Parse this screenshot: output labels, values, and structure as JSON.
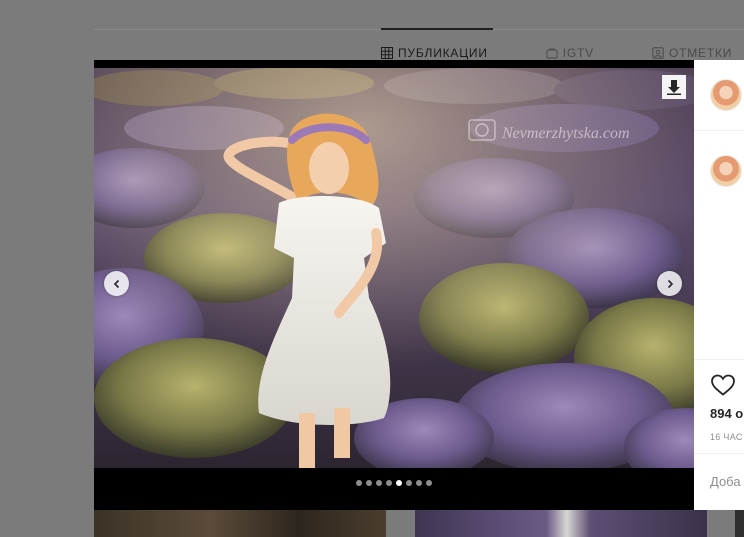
{
  "profile_tabs": [
    {
      "label": "ПУБЛИКАЦИИ",
      "icon": "grid-icon"
    },
    {
      "label": "IGTV",
      "icon": "igtv-icon"
    },
    {
      "label": "ОТМЕТКИ",
      "icon": "tagged-icon"
    }
  ],
  "photo": {
    "watermark": "Nevmerzhytska.com",
    "slide_count": 8,
    "active_slide": 5
  },
  "side_panel": {
    "likes_text": "894 о",
    "time_text": "16 ЧАС",
    "comment_placeholder": "Доба"
  },
  "colors": {
    "like_stroke": "#262626",
    "panel_bg": "#ffffff",
    "overlay": "#7b7b7b"
  }
}
